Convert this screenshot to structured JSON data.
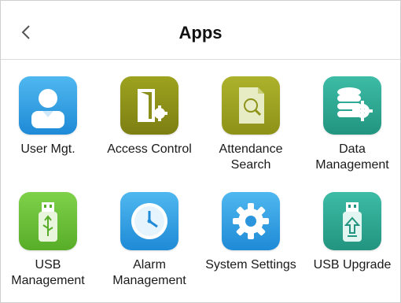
{
  "header": {
    "title": "Apps",
    "back_icon": "chevron-left-icon"
  },
  "apps": [
    {
      "label_lines": [
        "User Mgt."
      ],
      "icon": "user-icon",
      "color": "#2f9fe3"
    },
    {
      "label_lines": [
        "Access Control"
      ],
      "icon": "door-gear-icon",
      "color": "#8c8e1a"
    },
    {
      "label_lines": [
        "Attendance",
        "Search"
      ],
      "icon": "document-search-icon",
      "color": "#9aa022"
    },
    {
      "label_lines": [
        "Data",
        "Management"
      ],
      "icon": "database-gear-icon",
      "color": "#2ea995"
    },
    {
      "label_lines": [
        "USB",
        "Management"
      ],
      "icon": "usb-drive-icon",
      "color": "#6fc23a"
    },
    {
      "label_lines": [
        "Alarm",
        "Management"
      ],
      "icon": "clock-icon",
      "color": "#2f9fe3"
    },
    {
      "label_lines": [
        "System Settings"
      ],
      "icon": "gear-icon",
      "color": "#2f9fe3"
    },
    {
      "label_lines": [
        "USB Upgrade"
      ],
      "icon": "usb-upgrade-icon",
      "color": "#2ea995"
    }
  ]
}
